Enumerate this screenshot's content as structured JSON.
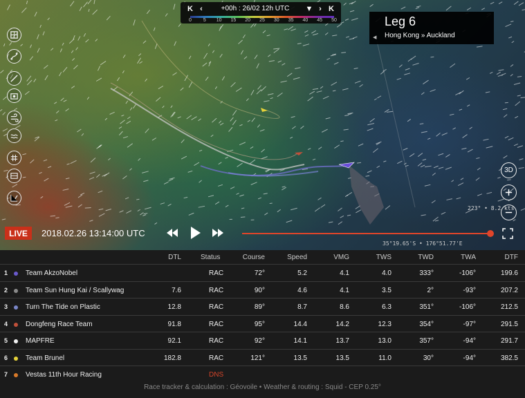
{
  "timebar": {
    "label": "+00h : 26/02 12h UTC",
    "scale": [
      "0",
      "5",
      "10",
      "15",
      "20",
      "25",
      "30",
      "35",
      "40",
      "45",
      "50"
    ]
  },
  "leg": {
    "title": "Leg 6",
    "route": "Hong Kong » Auckland"
  },
  "controls": {
    "view3d": "3D",
    "wind_readout": "223° • 8.2 kts",
    "coords": "35°19.65'S • 176°51.77'E"
  },
  "playback": {
    "live": "LIVE",
    "datetime": "2018.02.26 13:14:00 UTC",
    "progress": 0.99
  },
  "table": {
    "headers": {
      "dtl": "DTL",
      "status": "Status",
      "course": "Course",
      "speed": "Speed",
      "vmg": "VMG",
      "tws": "TWS",
      "twd": "TWD",
      "twa": "TWA",
      "dtf": "DTF"
    },
    "rows": [
      {
        "rank": "1",
        "team": "Team AkzoNobel",
        "color": "#6a5acd",
        "dtl": "",
        "status": "RAC",
        "course": "72°",
        "speed": "5.2",
        "vmg": "4.1",
        "tws": "4.0",
        "twd": "333°",
        "twa": "-106°",
        "dtf": "199.6"
      },
      {
        "rank": "2",
        "team": "Team Sun Hung Kai / Scallywag",
        "color": "#8a8a8a",
        "dtl": "7.6",
        "status": "RAC",
        "course": "90°",
        "speed": "4.6",
        "vmg": "4.1",
        "tws": "3.5",
        "twd": "2°",
        "twa": "-93°",
        "dtf": "207.2"
      },
      {
        "rank": "3",
        "team": "Turn The Tide on Plastic",
        "color": "#7a86c8",
        "dtl": "12.8",
        "status": "RAC",
        "course": "89°",
        "speed": "8.7",
        "vmg": "8.6",
        "tws": "6.3",
        "twd": "351°",
        "twa": "-106°",
        "dtf": "212.5"
      },
      {
        "rank": "4",
        "team": "Dongfeng Race Team",
        "color": "#c0503a",
        "dtl": "91.8",
        "status": "RAC",
        "course": "95°",
        "speed": "14.4",
        "vmg": "14.2",
        "tws": "12.3",
        "twd": "354°",
        "twa": "-97°",
        "dtf": "291.5"
      },
      {
        "rank": "5",
        "team": "MAPFRE",
        "color": "#f2f2f2",
        "dtl": "92.1",
        "status": "RAC",
        "course": "92°",
        "speed": "14.1",
        "vmg": "13.7",
        "tws": "13.0",
        "twd": "357°",
        "twa": "-94°",
        "dtf": "291.7"
      },
      {
        "rank": "6",
        "team": "Team Brunel",
        "color": "#e6d23a",
        "dtl": "182.8",
        "status": "RAC",
        "course": "121°",
        "speed": "13.5",
        "vmg": "13.5",
        "tws": "11.0",
        "twd": "30°",
        "twa": "-94°",
        "dtf": "382.5"
      },
      {
        "rank": "7",
        "team": "Vestas 11th Hour Racing",
        "color": "#d87a2a",
        "dtl": "",
        "status": "DNS",
        "course": "",
        "speed": "",
        "vmg": "",
        "tws": "",
        "twd": "",
        "twa": "",
        "dtf": ""
      }
    ],
    "footer": "Race tracker & calculation : Géovoile • Weather & routing : Squid - CEP 0.25°"
  }
}
